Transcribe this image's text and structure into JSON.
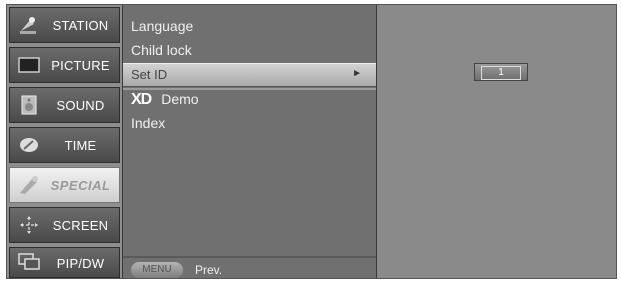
{
  "categories": [
    {
      "label": "STATION",
      "icon": "station-icon"
    },
    {
      "label": "PICTURE",
      "icon": "picture-icon"
    },
    {
      "label": "SOUND",
      "icon": "sound-icon"
    },
    {
      "label": "TIME",
      "icon": "time-icon"
    },
    {
      "label": "SPECIAL",
      "icon": "special-icon",
      "active": true
    },
    {
      "label": "SCREEN",
      "icon": "screen-icon"
    },
    {
      "label": "PIP/DW",
      "icon": "pip-icon"
    }
  ],
  "submenu": {
    "items": [
      "Language",
      "Child lock",
      "Set ID",
      "Demo",
      "Index"
    ],
    "xd_logo": "XD",
    "selected_arrow": "►"
  },
  "footer": {
    "menu_label": "MENU",
    "prev_label": "Prev."
  },
  "set_id": {
    "value": "1"
  }
}
